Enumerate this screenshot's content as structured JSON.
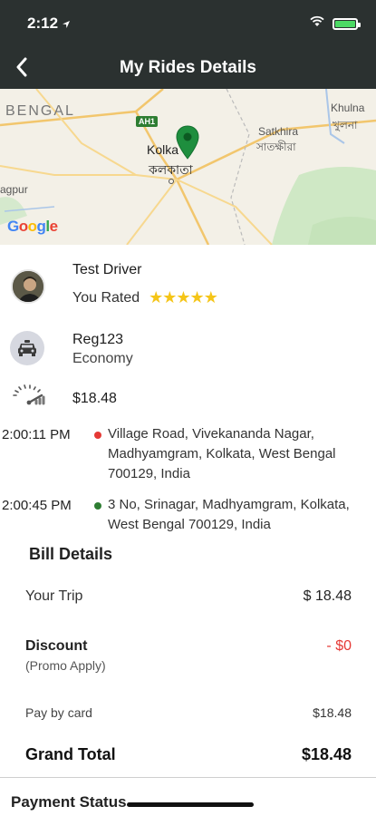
{
  "status_bar": {
    "time": "2:12",
    "icons": [
      "location-arrow-icon",
      "wifi-icon",
      "battery-charging-icon"
    ],
    "battery_color": "#4cd964"
  },
  "header": {
    "title": "My Rides Details",
    "back_icon": "chevron-left-icon",
    "background": "#2b3130"
  },
  "map": {
    "labels": {
      "region": "BENGAL",
      "city": "Kolka",
      "city_bengali": "কলকাতা",
      "highway": "AH1",
      "satkhira": "Satkhira",
      "satkhira_bengali": "সাতক্ষীরা",
      "khulna": "Khulna",
      "khulna_bengali": "খুলনা",
      "left_place": "agpur"
    },
    "provider": [
      "G",
      "o",
      "o",
      "g",
      "l",
      "e"
    ],
    "pin_color": "#1e8e3e"
  },
  "driver": {
    "name": "Test Driver",
    "rated_label": "You Rated",
    "stars": "★★★★★",
    "rating": 5
  },
  "vehicle": {
    "registration": "Reg123",
    "type": "Economy"
  },
  "fare": {
    "amount": "$18.48"
  },
  "trip": {
    "pickup": {
      "time": "2:00:11 PM",
      "address": "Village Road, Vivekananda Nagar, Madhyamgram, Kolkata, West Bengal 700129, India",
      "dot_color": "#e53935"
    },
    "dropoff": {
      "time": "2:00:45 PM",
      "address": "3 No, Srinagar, Madhyamgram, Kolkata, West Bengal 700129, India",
      "dot_color": "#2e7d32"
    }
  },
  "bill": {
    "title": "Bill Details",
    "your_trip_label": "Your Trip",
    "your_trip_value": "$ 18.48",
    "discount_label": "Discount",
    "discount_sub": "(Promo Apply)",
    "discount_value": "- $0",
    "pay_label": "Pay by card",
    "pay_value": "$18.48",
    "grand_label": "Grand Total",
    "grand_value": "$18.48"
  },
  "payment": {
    "title": "Payment Status"
  }
}
